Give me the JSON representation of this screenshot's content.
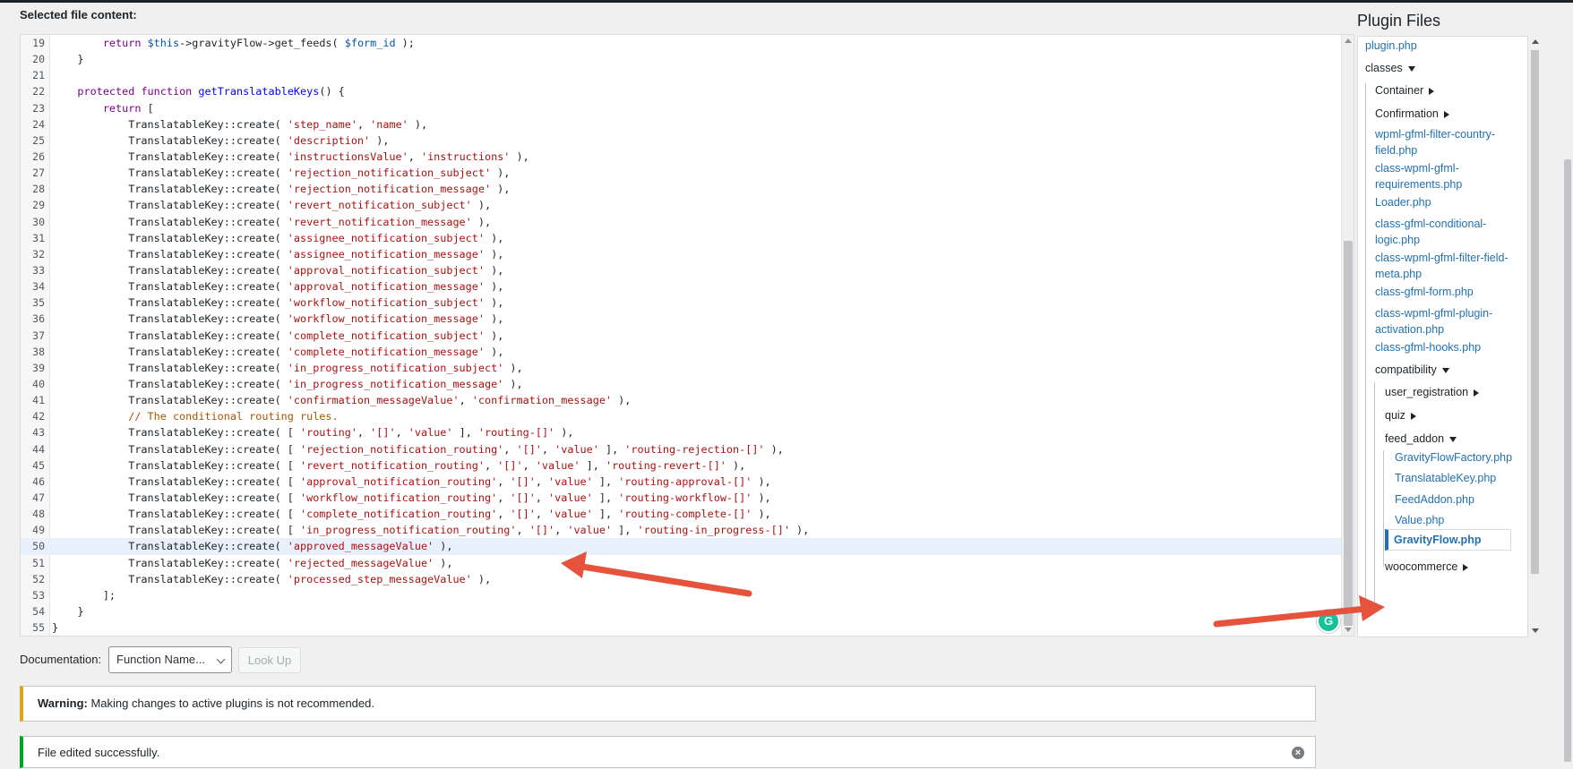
{
  "editor": {
    "label": "Selected file content:",
    "lines": [
      {
        "n": "19",
        "code": "        return $this->gravityFlow->get_feeds( $form_id );"
      },
      {
        "n": "20",
        "code": "    }"
      },
      {
        "n": "21",
        "code": ""
      },
      {
        "n": "22",
        "code": "    protected function getTranslatableKeys() {"
      },
      {
        "n": "23",
        "code": "        return ["
      },
      {
        "n": "24",
        "code": "            TranslatableKey::create( 'step_name', 'name' ),"
      },
      {
        "n": "25",
        "code": "            TranslatableKey::create( 'description' ),"
      },
      {
        "n": "26",
        "code": "            TranslatableKey::create( 'instructionsValue', 'instructions' ),"
      },
      {
        "n": "27",
        "code": "            TranslatableKey::create( 'rejection_notification_subject' ),"
      },
      {
        "n": "28",
        "code": "            TranslatableKey::create( 'rejection_notification_message' ),"
      },
      {
        "n": "29",
        "code": "            TranslatableKey::create( 'revert_notification_subject' ),"
      },
      {
        "n": "30",
        "code": "            TranslatableKey::create( 'revert_notification_message' ),"
      },
      {
        "n": "31",
        "code": "            TranslatableKey::create( 'assignee_notification_subject' ),"
      },
      {
        "n": "32",
        "code": "            TranslatableKey::create( 'assignee_notification_message' ),"
      },
      {
        "n": "33",
        "code": "            TranslatableKey::create( 'approval_notification_subject' ),"
      },
      {
        "n": "34",
        "code": "            TranslatableKey::create( 'approval_notification_message' ),"
      },
      {
        "n": "35",
        "code": "            TranslatableKey::create( 'workflow_notification_subject' ),"
      },
      {
        "n": "36",
        "code": "            TranslatableKey::create( 'workflow_notification_message' ),"
      },
      {
        "n": "37",
        "code": "            TranslatableKey::create( 'complete_notification_subject' ),"
      },
      {
        "n": "38",
        "code": "            TranslatableKey::create( 'complete_notification_message' ),"
      },
      {
        "n": "39",
        "code": "            TranslatableKey::create( 'in_progress_notification_subject' ),"
      },
      {
        "n": "40",
        "code": "            TranslatableKey::create( 'in_progress_notification_message' ),"
      },
      {
        "n": "41",
        "code": "            TranslatableKey::create( 'confirmation_messageValue', 'confirmation_message' ),"
      },
      {
        "n": "42",
        "code": "            // The conditional routing rules."
      },
      {
        "n": "43",
        "code": "            TranslatableKey::create( [ 'routing', '[]', 'value' ], 'routing-[]' ),"
      },
      {
        "n": "44",
        "code": "            TranslatableKey::create( [ 'rejection_notification_routing', '[]', 'value' ], 'routing-rejection-[]' ),"
      },
      {
        "n": "45",
        "code": "            TranslatableKey::create( [ 'revert_notification_routing', '[]', 'value' ], 'routing-revert-[]' ),"
      },
      {
        "n": "46",
        "code": "            TranslatableKey::create( [ 'approval_notification_routing', '[]', 'value' ], 'routing-approval-[]' ),"
      },
      {
        "n": "47",
        "code": "            TranslatableKey::create( [ 'workflow_notification_routing', '[]', 'value' ], 'routing-workflow-[]' ),"
      },
      {
        "n": "48",
        "code": "            TranslatableKey::create( [ 'complete_notification_routing', '[]', 'value' ], 'routing-complete-[]' ),"
      },
      {
        "n": "49",
        "code": "            TranslatableKey::create( [ 'in_progress_notification_routing', '[]', 'value' ], 'routing-in_progress-[]' ),"
      },
      {
        "n": "50",
        "code": "            TranslatableKey::create( 'approved_messageValue' ),"
      },
      {
        "n": "51",
        "code": "            TranslatableKey::create( 'rejected_messageValue' ),"
      },
      {
        "n": "52",
        "code": "            TranslatableKey::create( 'processed_step_messageValue' ),"
      },
      {
        "n": "53",
        "code": "        ];"
      },
      {
        "n": "54",
        "code": "    }"
      },
      {
        "n": "55",
        "code": "}"
      }
    ],
    "highlighted_line": "50"
  },
  "plugin_files": {
    "title": "Plugin Files",
    "items": {
      "plugin_php": "plugin.php",
      "classes": "classes",
      "container": "Container",
      "confirmation": "Confirmation",
      "filter_country_field": "wpml-gfml-filter-country-field.php",
      "requirements": "class-wpml-gfml-requirements.php",
      "loader": "Loader.php",
      "conditional_logic": "class-gfml-conditional-logic.php",
      "filter_field_meta": "class-wpml-gfml-filter-field-meta.php",
      "gfml_form": "class-gfml-form.php",
      "plugin_activation": "class-wpml-gfml-plugin-activation.php",
      "gfml_hooks": "class-gfml-hooks.php",
      "compatibility": "compatibility",
      "user_registration": "user_registration",
      "quiz": "quiz",
      "feed_addon": "feed_addon",
      "gravity_flow_factory": "GravityFlowFactory.php",
      "translatable_key": "TranslatableKey.php",
      "feed_addon_php": "FeedAddon.php",
      "value_php": "Value.php",
      "gravity_flow": "GravityFlow.php",
      "woocommerce": "woocommerce"
    }
  },
  "documentation": {
    "label": "Documentation:",
    "select_value": "Function Name...",
    "lookup_label": "Look Up"
  },
  "notices": {
    "warning_strong": "Warning:",
    "warning_text": "Making changes to active plugins is not recommended.",
    "success_text": "File edited successfully."
  },
  "colors": {
    "accent": "#2271b1",
    "warning": "#dba617",
    "success": "#00a32a",
    "annotation_arrow": "#e5533c"
  },
  "icons": {
    "grammarly": "grammarly-icon",
    "dismiss": "dismiss-icon"
  }
}
